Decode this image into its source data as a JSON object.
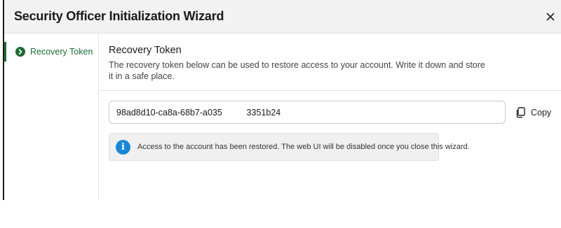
{
  "window": {
    "title": "Security Officer Initialization Wizard",
    "close_icon": "close-icon"
  },
  "sidebar": {
    "items": [
      {
        "label": "Recovery Token",
        "icon": "chevron-right-circle-icon",
        "active": true
      }
    ],
    "accent_color": "#1b6e33"
  },
  "main": {
    "section_title": "Recovery Token",
    "description": "The recovery token below can be used to restore access to your account. Write it down and store it in a safe place.",
    "token_value": "98ad8d10-ca8a-68b7-a035          3351b24",
    "copy_label": "Copy",
    "copy_icon": "copy-icon",
    "info": {
      "icon": "info-icon",
      "text": "Access to the account has been restored. The web UI will be disabled once you close this wizard.",
      "icon_color": "#1a86d6"
    }
  }
}
